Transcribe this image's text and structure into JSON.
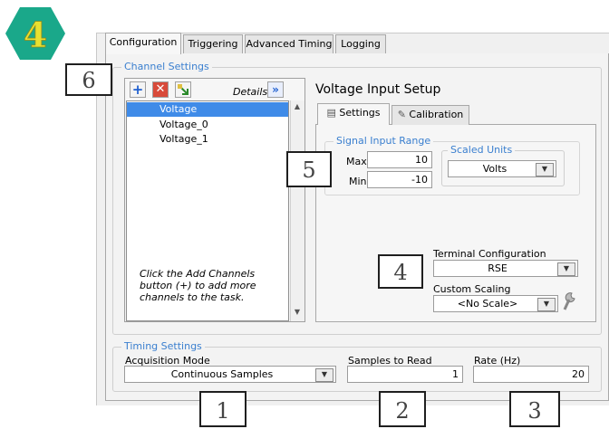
{
  "badge": {
    "text": "4",
    "color": "#1aa88a",
    "text_color": "#e8e030"
  },
  "tabs": [
    "Configuration",
    "Triggering",
    "Advanced Timing",
    "Logging"
  ],
  "channel_settings": {
    "label": "Channel Settings",
    "details_label": "Details",
    "add_icon": "plus-icon",
    "remove_icon": "x-icon",
    "sort_icon": "sort-icon",
    "details_icon": "double-chevron-icon",
    "channels": [
      "Voltage",
      "Voltage_0",
      "Voltage_1"
    ],
    "selected_channel": "Voltage",
    "hint": "Click the Add Channels button (+) to add more channels to the task."
  },
  "voltage_setup": {
    "title": "Voltage Input Setup",
    "subtabs": [
      "Settings",
      "Calibration"
    ],
    "signal_range": {
      "label": "Signal Input Range",
      "max_label": "Max",
      "max_value": "10",
      "min_label": "Min",
      "min_value": "-10"
    },
    "scaled_units": {
      "label": "Scaled Units",
      "value": "Volts"
    },
    "terminal_config": {
      "label": "Terminal Configuration",
      "value": "RSE"
    },
    "custom_scaling": {
      "label": "Custom Scaling",
      "value": "<No Scale>"
    }
  },
  "timing": {
    "label": "Timing Settings",
    "acq_mode_label": "Acquisition Mode",
    "acq_mode_value": "Continuous Samples",
    "samples_label": "Samples to Read",
    "samples_value": "1",
    "rate_label": "Rate (Hz)",
    "rate_value": "20"
  },
  "callouts": {
    "c1": "1",
    "c2": "2",
    "c3": "3",
    "c4": "4",
    "c5": "5",
    "c6": "6"
  }
}
